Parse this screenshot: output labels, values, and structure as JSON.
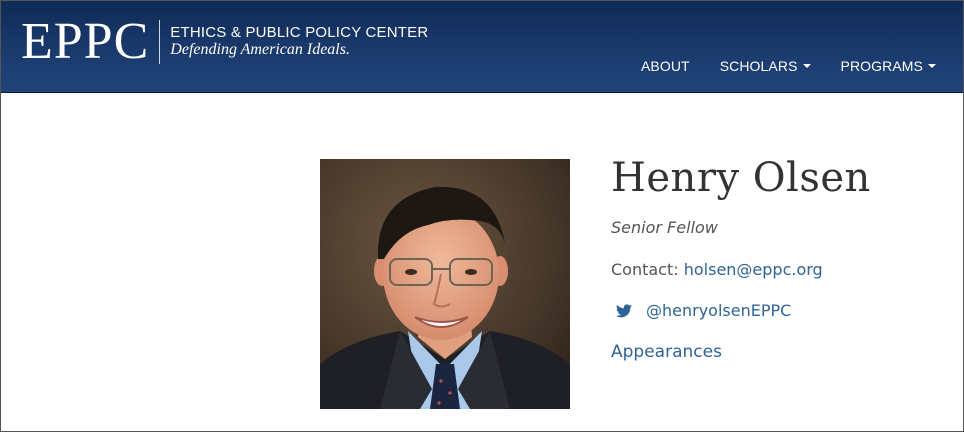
{
  "header": {
    "logo_mark": "EPPC",
    "logo_name": "ETHICS & PUBLIC POLICY CENTER",
    "logo_tagline": "Defending American Ideals.",
    "colors": {
      "bar": "#1a3a6c",
      "text": "#ffffff"
    }
  },
  "nav": {
    "items": [
      {
        "label": "ABOUT",
        "has_dropdown": false
      },
      {
        "label": "SCHOLARS",
        "has_dropdown": true
      },
      {
        "label": "PROGRAMS",
        "has_dropdown": true
      }
    ]
  },
  "profile": {
    "name": "Henry Olsen",
    "title": "Senior Fellow",
    "contact_label": "Contact:",
    "email": "holsen@eppc.org",
    "twitter_icon": "twitter-bird-icon",
    "twitter_handle": "@henryolsenEPPC",
    "appearances_label": "Appearances",
    "link_color": "#2f6497"
  }
}
